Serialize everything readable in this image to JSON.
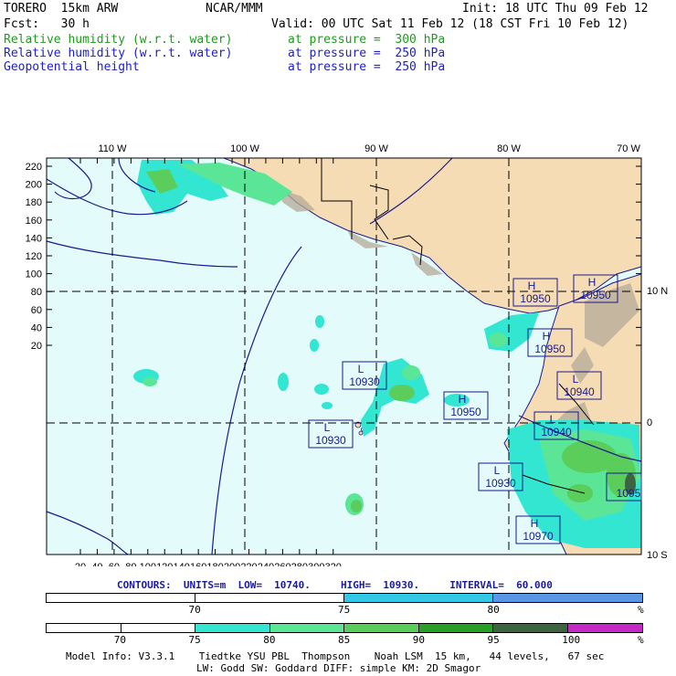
{
  "header": {
    "model": "TORERO  15km ARW",
    "center": "NCAR/MMM",
    "init": "Init: 18 UTC Thu 09 Feb 12",
    "fcst": "Fcst:   30 h",
    "valid": "Valid: 00 UTC Sat 11 Feb 12 (18 CST Fri 10 Feb 12)",
    "fields": [
      {
        "name": "Relative humidity (w.r.t. water)",
        "level": "at pressure =  300 hPa",
        "color": "#1f9a1f"
      },
      {
        "name": "Relative humidity (w.r.t. water)",
        "level": "at pressure =  250 hPa",
        "color": "#2020c8"
      },
      {
        "name": "Geopotential height",
        "level": "at pressure =  250 hPa",
        "color": "#000000"
      }
    ]
  },
  "map": {
    "lon_labels": [
      "110 W",
      "100 W",
      "90 W",
      "80 W",
      "70 W"
    ],
    "lat_labels": [
      "10 N",
      "0",
      "10 S"
    ],
    "x_ticks": [
      "20",
      "40",
      "60",
      "80",
      "100",
      "120",
      "140",
      "160",
      "180",
      "200",
      "220",
      "240",
      "260",
      "280",
      "300",
      "320"
    ],
    "y_ticks": [
      "220",
      "200",
      "180",
      "160",
      "140",
      "120",
      "100",
      "80",
      "60",
      "40",
      "20"
    ],
    "ocean_color": "#e4fbfb",
    "land_color": "#f5dcb4",
    "centers": [
      {
        "type": "H",
        "value": "10950"
      },
      {
        "type": "H",
        "value": "10950"
      },
      {
        "type": "H",
        "value": "10950"
      },
      {
        "type": "L",
        "value": "10930"
      },
      {
        "type": "H",
        "value": "10950"
      },
      {
        "type": "L",
        "value": "10940"
      },
      {
        "type": "L",
        "value": "10930"
      },
      {
        "type": "L",
        "value": "10940"
      },
      {
        "type": "L",
        "value": "10930"
      },
      {
        "type": "H",
        "value": "10970"
      },
      {
        "type": "",
        "value": "1095"
      }
    ]
  },
  "contours": {
    "text": "CONTOURS:  UNITS=m  LOW=  10740.     HIGH=  10930.     INTERVAL=  60.000"
  },
  "colorbar_250": {
    "colors": [
      "#ffffff",
      "#ffffff",
      "#33c8e6",
      "#5a96e6"
    ],
    "labels": [
      "70",
      "75",
      "80"
    ],
    "unit": "%"
  },
  "colorbar_300": {
    "colors": [
      "#ffffff",
      "#ffffff",
      "#33e6d2",
      "#5ae696",
      "#5acd5a",
      "#28a028",
      "#3c6440",
      "#c828c8"
    ],
    "labels": [
      "70",
      "75",
      "80",
      "85",
      "90",
      "95",
      "100"
    ],
    "unit": "%"
  },
  "footer": {
    "line1": "Model Info: V3.3.1    Tiedtke YSU PBL  Thompson    Noah LSM  15 km,   44 levels,   67 sec",
    "line2": "LW: Godd SW: Goddard DIFF: simple KM: 2D Smagor"
  }
}
